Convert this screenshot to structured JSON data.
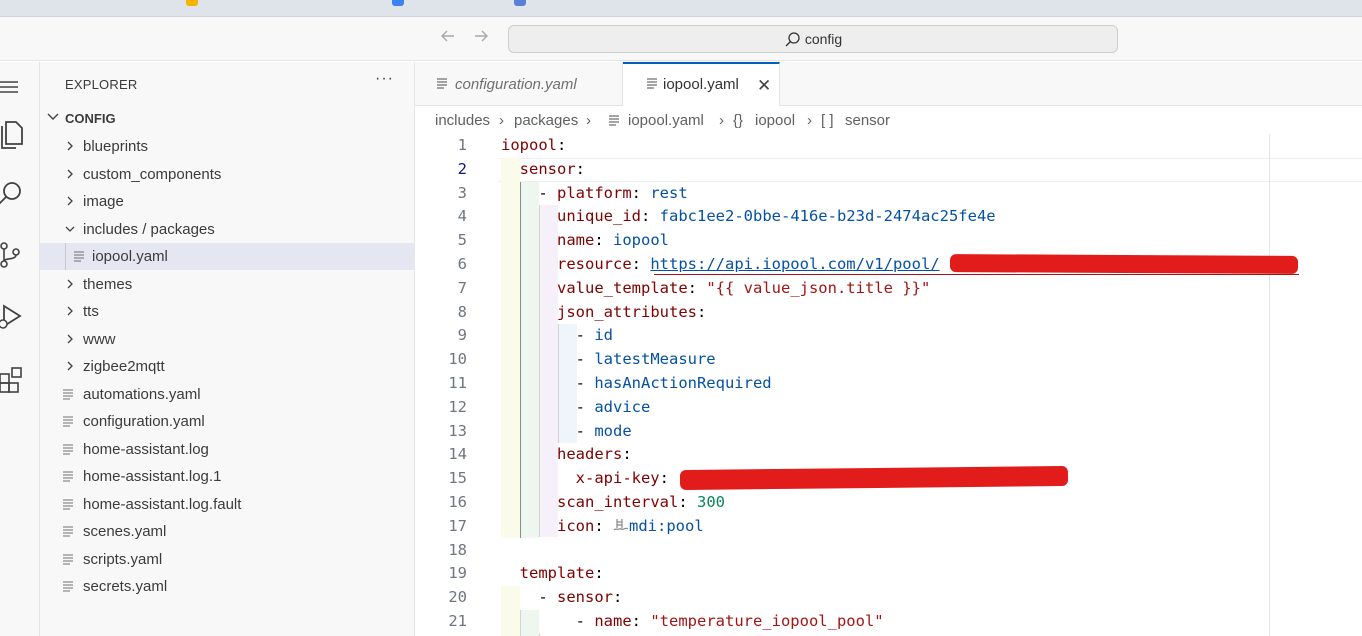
{
  "app": {
    "search_text": "config"
  },
  "sidebar": {
    "title": "EXPLORER",
    "more_label": "···",
    "root_folder": "CONFIG",
    "items": [
      {
        "label": "blueprints",
        "type": "folder"
      },
      {
        "label": "custom_components",
        "type": "folder"
      },
      {
        "label": "image",
        "type": "folder"
      },
      {
        "label": "includes / packages",
        "type": "folder-open"
      },
      {
        "label": "iopool.yaml",
        "type": "file",
        "selected": true
      },
      {
        "label": "themes",
        "type": "folder"
      },
      {
        "label": "tts",
        "type": "folder"
      },
      {
        "label": "www",
        "type": "folder"
      },
      {
        "label": "zigbee2mqtt",
        "type": "folder"
      },
      {
        "label": "automations.yaml",
        "type": "file"
      },
      {
        "label": "configuration.yaml",
        "type": "file"
      },
      {
        "label": "home-assistant.log",
        "type": "file"
      },
      {
        "label": "home-assistant.log.1",
        "type": "file"
      },
      {
        "label": "home-assistant.log.fault",
        "type": "file"
      },
      {
        "label": "scenes.yaml",
        "type": "file"
      },
      {
        "label": "scripts.yaml",
        "type": "file"
      },
      {
        "label": "secrets.yaml",
        "type": "file"
      }
    ]
  },
  "tabs": [
    {
      "label": "configuration.yaml",
      "active": false
    },
    {
      "label": "iopool.yaml",
      "active": true,
      "close": "✕"
    }
  ],
  "breadcrumb": [
    "includes",
    "packages",
    "iopool.yaml",
    "iopool",
    "sensor"
  ],
  "editor": {
    "line_numbers": [
      "1",
      "2",
      "3",
      "4",
      "5",
      "6",
      "7",
      "8",
      "9",
      "10",
      "11",
      "12",
      "13",
      "14",
      "15",
      "16",
      "17",
      "18",
      "19",
      "20",
      "21"
    ],
    "active_line": "2",
    "lines": {
      "l1_key": "iopool",
      "l2_key": "sensor",
      "l3_key": "platform",
      "l3_val": "rest",
      "l4_key": "unique_id",
      "l4_val": "fabc1ee2-0bbe-416e-b23d-2474ac25fe4e",
      "l5_key": "name",
      "l5_val": "iopool",
      "l6_key": "resource",
      "l6_val": "https://api.iopool.com/v1/pool/",
      "l7_key": "value_template",
      "l7_val": "\"{{ value_json.title }}\"",
      "l8_key": "json_attributes",
      "l9_val": "id",
      "l10_val": "latestMeasure",
      "l11_val": "hasAnActionRequired",
      "l12_val": "advice",
      "l13_val": "mode",
      "l14_key": "headers",
      "l15_key": "x-api-key",
      "l16_key": "scan_interval",
      "l16_val": "300",
      "l17_key": "icon",
      "l17_val": "mdi:pool",
      "l19_key": "template",
      "l20_key": "sensor",
      "l21_key": "name",
      "l21_val": "\"temperature_iopool_pool\""
    }
  },
  "colors": {
    "accent": "#005fb8",
    "redaction": "#e21b1b"
  }
}
